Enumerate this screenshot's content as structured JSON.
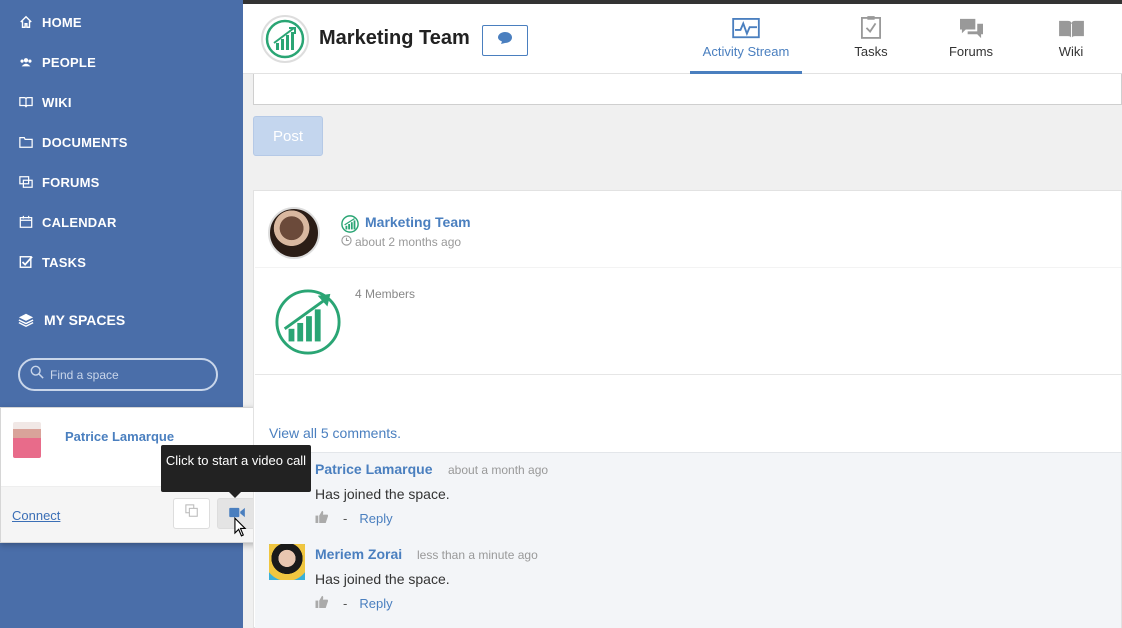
{
  "sidebar": {
    "nav": [
      {
        "label": "HOME",
        "icon": "home-icon"
      },
      {
        "label": "PEOPLE",
        "icon": "people-icon"
      },
      {
        "label": "WIKI",
        "icon": "wiki-icon"
      },
      {
        "label": "DOCUMENTS",
        "icon": "folder-icon"
      },
      {
        "label": "FORUMS",
        "icon": "forums-icon"
      },
      {
        "label": "CALENDAR",
        "icon": "calendar-icon"
      },
      {
        "label": "TASKS",
        "icon": "tasks-icon"
      }
    ],
    "my_spaces": "MY SPACES",
    "find_space_placeholder": "Find a space"
  },
  "popover": {
    "name": "Patrice Lamarque",
    "connect": "Connect",
    "tooltip": "Click to start a video call"
  },
  "header": {
    "title": "Marketing Team",
    "tabs": [
      {
        "label": "Activity Stream",
        "icon": "activity-icon",
        "active": true
      },
      {
        "label": "Tasks",
        "icon": "tasks-clipboard-icon",
        "active": false
      },
      {
        "label": "Forums",
        "icon": "forums-bubbles-icon",
        "active": false
      },
      {
        "label": "Wiki",
        "icon": "wiki-book-icon",
        "active": false
      }
    ]
  },
  "composer": {
    "post_label": "Post"
  },
  "activity": {
    "space_name": "Marketing Team",
    "time": "about 2 months ago",
    "members": "4 Members",
    "view_all": "View all 5 comments.",
    "comments": [
      {
        "name": "Patrice Lamarque",
        "time": "about a month ago",
        "text": "Has joined the space.",
        "reply": "Reply",
        "sep": "-"
      },
      {
        "name": "Meriem Zorai",
        "time": "less than a minute ago",
        "text": "Has joined the space.",
        "reply": "Reply",
        "sep": "-"
      }
    ]
  },
  "colors": {
    "sidebar": "#4a6ea9",
    "accent": "#4a7fbf",
    "space_green": "#2aa574"
  }
}
